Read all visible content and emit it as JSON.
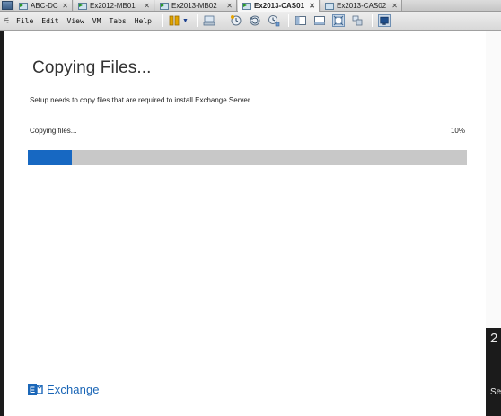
{
  "tabs": [
    {
      "label": "ABC-DC",
      "active": false,
      "powered": true
    },
    {
      "label": "Ex2012-MB01",
      "active": false,
      "powered": true
    },
    {
      "label": "Ex2013-MB02",
      "active": false,
      "powered": true
    },
    {
      "label": "Ex2013-CAS01",
      "active": true,
      "powered": true
    },
    {
      "label": "Ex2013-CAS02",
      "active": false,
      "powered": false
    }
  ],
  "menu": [
    "File",
    "Edit",
    "View",
    "VM",
    "Tabs",
    "Help"
  ],
  "toolbar_icons": [
    "pause-icon",
    "connect-network-icon",
    "snapshot-icon",
    "revert-snapshot-icon",
    "snapshot-manager-icon",
    "sidebar-toggle-icon",
    "thumbnail-bar-icon",
    "full-screen-icon",
    "unity-icon",
    "console-view-icon"
  ],
  "setup": {
    "title": "Copying Files...",
    "description": "Setup needs to copy files that are required to install Exchange Server.",
    "progress_label": "Copying files...",
    "progress_percent": "10%",
    "progress_value": 0.1
  },
  "logo": {
    "text": "Exchange"
  },
  "guest_edge": {
    "digit": "2",
    "fragment": "Se"
  },
  "colors": {
    "progress_fill": "#1768c2",
    "progress_track": "#c8c8c8",
    "logo": "#1864b5"
  }
}
